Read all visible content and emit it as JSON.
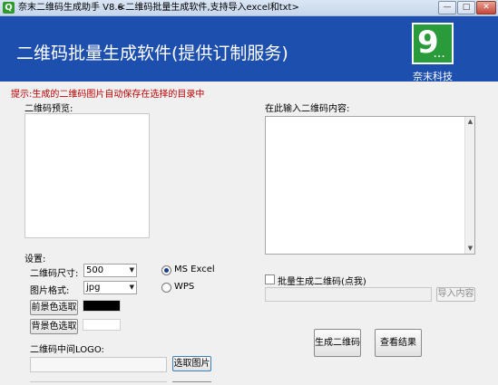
{
  "window": {
    "app_title": "奈末二维码生成助手 V8.6",
    "subtitle": "<二维码批量生成软件,支持导入excel和txt>",
    "icon_glyph": "Q",
    "minimize_glyph": "—",
    "maximize_glyph": "□",
    "close_glyph": "✕"
  },
  "banner": {
    "title": "二维码批量生成软件(提供订制服务)",
    "logo_text": "9",
    "logo_dots": "...",
    "company": "奈末科技",
    "background_color": "#1d4fae",
    "logo_color": "#2a9b3a"
  },
  "tip": "提示:生成的二维码图片自动保存在选择的目录中",
  "preview": {
    "label": "二维码预览:"
  },
  "content": {
    "label": "在此输入二维码内容:",
    "value": ""
  },
  "settings": {
    "label": "设置:",
    "size_label": "二维码尺寸:",
    "size_value": "500",
    "format_label": "图片格式:",
    "format_value": "jpg",
    "radio_ms_excel": "MS  Excel",
    "radio_wps": "WPS",
    "foreground_button": "前景色选取",
    "background_button": "背景色选取",
    "foreground_color": "#000000",
    "background_color": "#ffffff",
    "logo_label": "二维码中间LOGO:",
    "logo_path": "",
    "choose_image_button": "选取图片"
  },
  "batch": {
    "checkbox_label": "批量生成二维码(点我)",
    "checked": false,
    "import_path": "",
    "import_button": "导入内容"
  },
  "actions": {
    "generate_button": "生成二维码",
    "view_results_button": "查看结果"
  }
}
